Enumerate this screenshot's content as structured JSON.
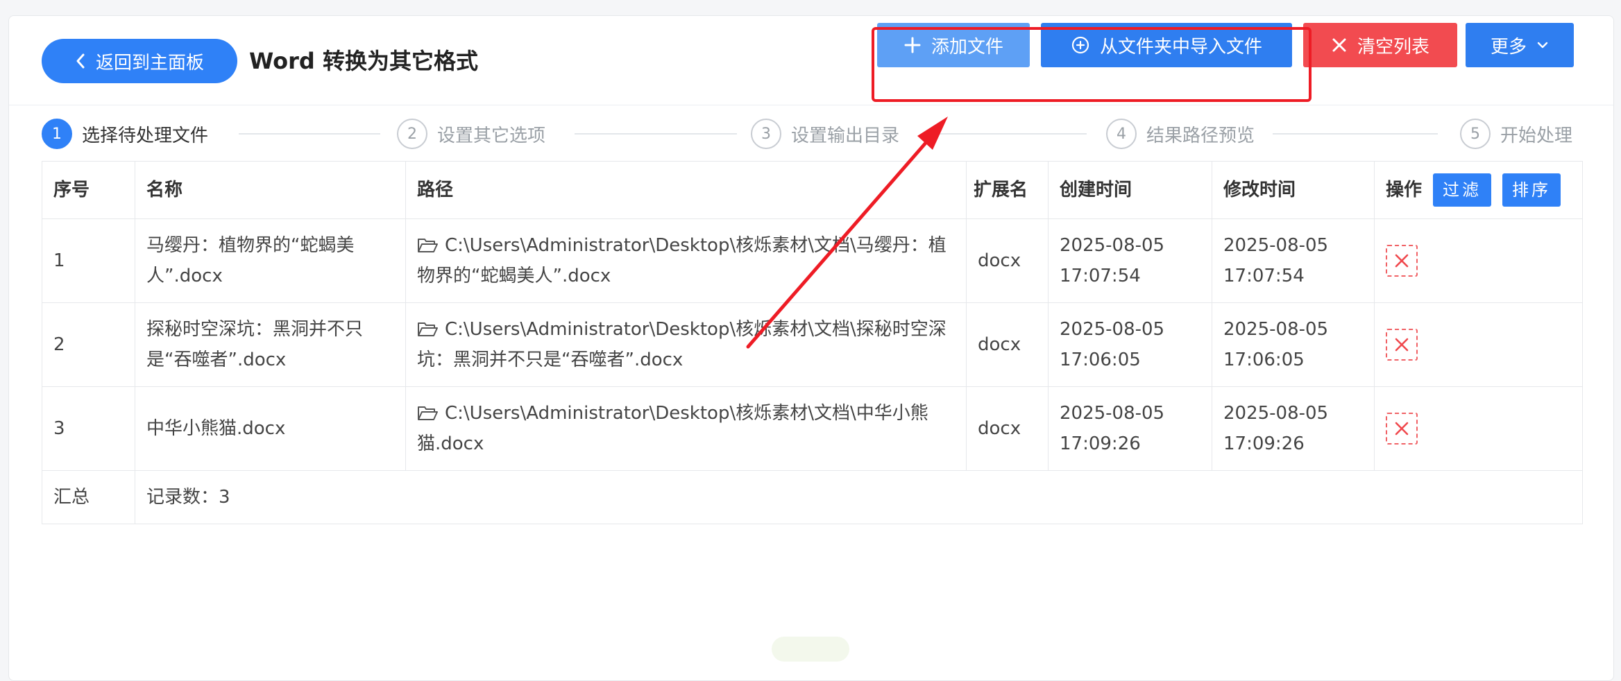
{
  "header": {
    "back_label": "返回到主面板",
    "title": "Word 转换为其它格式",
    "add_file_label": "添加文件",
    "import_folder_label": "从文件夹中导入文件",
    "clear_list_label": "清空列表",
    "more_label": "更多"
  },
  "steps": [
    {
      "num": "1",
      "label": "选择待处理文件"
    },
    {
      "num": "2",
      "label": "设置其它选项"
    },
    {
      "num": "3",
      "label": "设置输出目录"
    },
    {
      "num": "4",
      "label": "结果路径预览"
    },
    {
      "num": "5",
      "label": "开始处理"
    }
  ],
  "table": {
    "columns": {
      "index": "序号",
      "name": "名称",
      "path": "路径",
      "ext": "扩展名",
      "created": "创建时间",
      "modified": "修改时间",
      "action": "操作"
    },
    "filter_label": "过滤",
    "sort_label": "排序",
    "rows": [
      {
        "index": "1",
        "name": "马缨丹：植物界的“蛇蝎美人”.docx",
        "path": "C:\\Users\\Administrator\\Desktop\\核烁素材\\文档\\马缨丹：植物界的“蛇蝎美人”.docx",
        "ext": "docx",
        "created": "2025-08-05 17:07:54",
        "modified": "2025-08-05 17:07:54"
      },
      {
        "index": "2",
        "name": "探秘时空深坑：黑洞并不只是“吞噬者”.docx",
        "path": "C:\\Users\\Administrator\\Desktop\\核烁素材\\文档\\探秘时空深坑：黑洞并不只是“吞噬者”.docx",
        "ext": "docx",
        "created": "2025-08-05 17:06:05",
        "modified": "2025-08-05 17:06:05"
      },
      {
        "index": "3",
        "name": "中华小熊猫.docx",
        "path": "C:\\Users\\Administrator\\Desktop\\核烁素材\\文档\\中华小熊猫.docx",
        "ext": "docx",
        "created": "2025-08-05 17:09:26",
        "modified": "2025-08-05 17:09:26"
      }
    ],
    "total_label": "汇总",
    "record_count_text": "记录数：3"
  },
  "icons": {
    "back": "chevron-left-icon",
    "add": "plus-icon",
    "import": "circle-plus-icon",
    "clear": "close-icon",
    "more": "chevron-down-icon",
    "folder": "folder-open-icon",
    "delete": "delete-x-icon"
  },
  "colors": {
    "primary": "#2f81f7",
    "add_button": "#5ea0f5",
    "danger": "#f24b50",
    "annotation": "#ee1c25"
  }
}
